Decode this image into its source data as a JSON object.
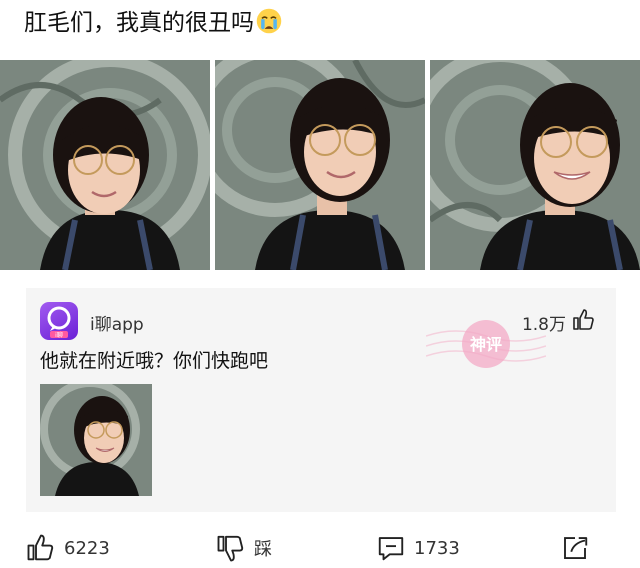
{
  "post": {
    "title": "肛毛们，我真的很丑吗",
    "emoji": "crying-face-emoji"
  },
  "photos": [
    {
      "name": "selfie-1"
    },
    {
      "name": "selfie-2"
    },
    {
      "name": "selfie-3"
    }
  ],
  "comment": {
    "app_name": "i聊app",
    "avatar_label": "i聊",
    "likes": "1.8万",
    "text": "他就在附近哦？你们快跑吧",
    "watermark_text": "神评"
  },
  "actions": {
    "like_count": "6223",
    "dislike_label": "踩",
    "comment_count": "1733"
  },
  "colors": {
    "avatar": "#8a3cf0",
    "watermark": "#f3a9c6",
    "card_bg": "#f5f5f5"
  }
}
